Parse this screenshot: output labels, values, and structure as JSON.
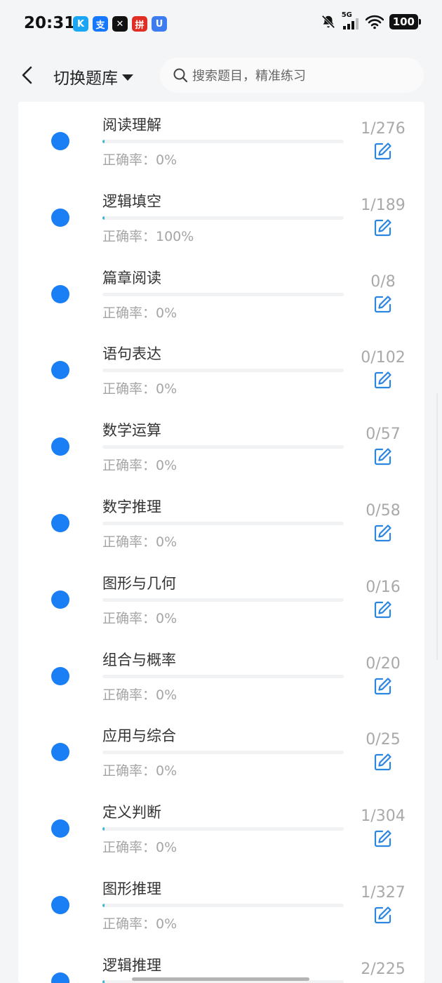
{
  "status_bar": {
    "time": "20:31",
    "apps": [
      {
        "icon": "kuaishou-icon",
        "glyph": "K",
        "color": "#1aa6f5"
      },
      {
        "icon": "alipay-icon",
        "glyph": "支",
        "color": "#1677ff"
      },
      {
        "icon": "capcut-icon",
        "glyph": "✕",
        "color": "#111111"
      },
      {
        "icon": "pinduoduo-icon",
        "glyph": "拼",
        "color": "#e02e24"
      },
      {
        "icon": "u-app-icon",
        "glyph": "U",
        "color": "#3d7cf0"
      }
    ],
    "signal_label": "5G",
    "battery": "100"
  },
  "header": {
    "back_icon": "chevron-left-icon",
    "switch_label": "切换题库",
    "search_placeholder": "搜索题目，精准练习"
  },
  "colors": {
    "accent": "#1a7ef5",
    "progress": "#3bb6d8",
    "edit": "#2b86e0"
  },
  "topics": [
    {
      "title": "阅读理解",
      "accuracy": "正确率：0%",
      "count": "1/276",
      "progress": 0.004
    },
    {
      "title": "逻辑填空",
      "accuracy": "正确率：100%",
      "count": "1/189",
      "progress": 0.005
    },
    {
      "title": "篇章阅读",
      "accuracy": "正确率：0%",
      "count": "0/8",
      "progress": 0
    },
    {
      "title": "语句表达",
      "accuracy": "正确率：0%",
      "count": "0/102",
      "progress": 0
    },
    {
      "title": "数学运算",
      "accuracy": "正确率：0%",
      "count": "0/57",
      "progress": 0
    },
    {
      "title": "数字推理",
      "accuracy": "正确率：0%",
      "count": "0/58",
      "progress": 0
    },
    {
      "title": "图形与几何",
      "accuracy": "正确率：0%",
      "count": "0/16",
      "progress": 0
    },
    {
      "title": "组合与概率",
      "accuracy": "正确率：0%",
      "count": "0/20",
      "progress": 0
    },
    {
      "title": "应用与综合",
      "accuracy": "正确率：0%",
      "count": "0/25",
      "progress": 0
    },
    {
      "title": "定义判断",
      "accuracy": "正确率：0%",
      "count": "1/304",
      "progress": 0.003
    },
    {
      "title": "图形推理",
      "accuracy": "正确率：0%",
      "count": "1/327",
      "progress": 0.003
    },
    {
      "title": "逻辑推理",
      "accuracy": "",
      "count": "2/225",
      "progress": 0.009
    }
  ]
}
